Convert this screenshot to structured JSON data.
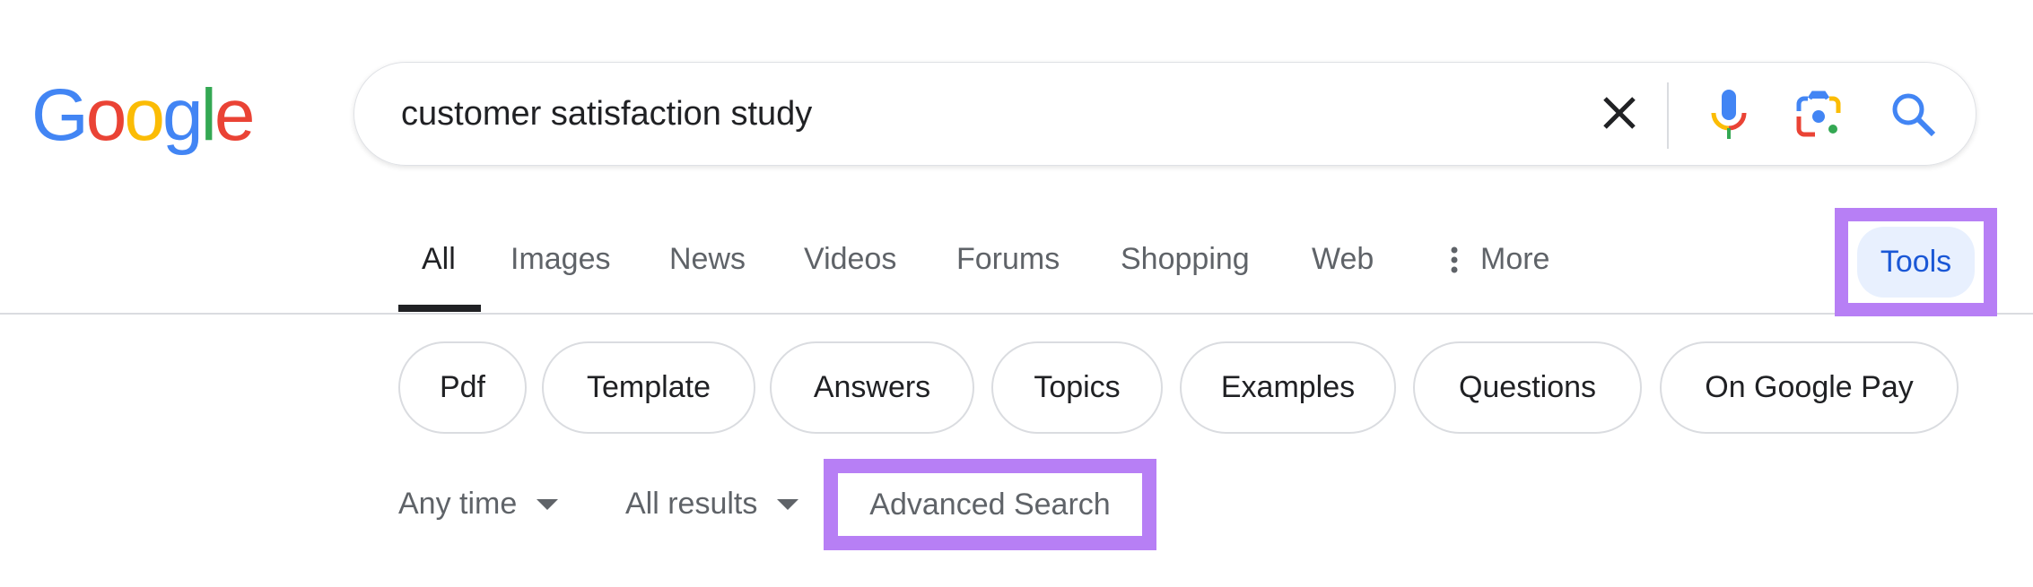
{
  "logo": {
    "letters": [
      "G",
      "o",
      "o",
      "g",
      "l",
      "e"
    ],
    "colors": [
      "#4285f4",
      "#ea4335",
      "#fbbc05",
      "#4285f4",
      "#34a853",
      "#ea4335"
    ]
  },
  "search": {
    "query": "customer satisfaction study",
    "icons": [
      "close-icon",
      "microphone-icon",
      "camera-lens-icon",
      "search-icon"
    ]
  },
  "tabs": [
    {
      "label": "All",
      "active": true
    },
    {
      "label": "Images"
    },
    {
      "label": "News"
    },
    {
      "label": "Videos"
    },
    {
      "label": "Forums"
    },
    {
      "label": "Shopping"
    },
    {
      "label": "Web"
    },
    {
      "label": "More"
    }
  ],
  "tools_label": "Tools",
  "chips": [
    "Pdf",
    "Template",
    "Answers",
    "Topics",
    "Examples",
    "Questions",
    "On Google Pay"
  ],
  "filters": {
    "time": "Any time",
    "results": "All results",
    "advanced": "Advanced Search"
  },
  "colors": {
    "highlight": "#b77ff5",
    "tools_bg": "#e8f0fe",
    "tools_text": "#1a57d6"
  }
}
